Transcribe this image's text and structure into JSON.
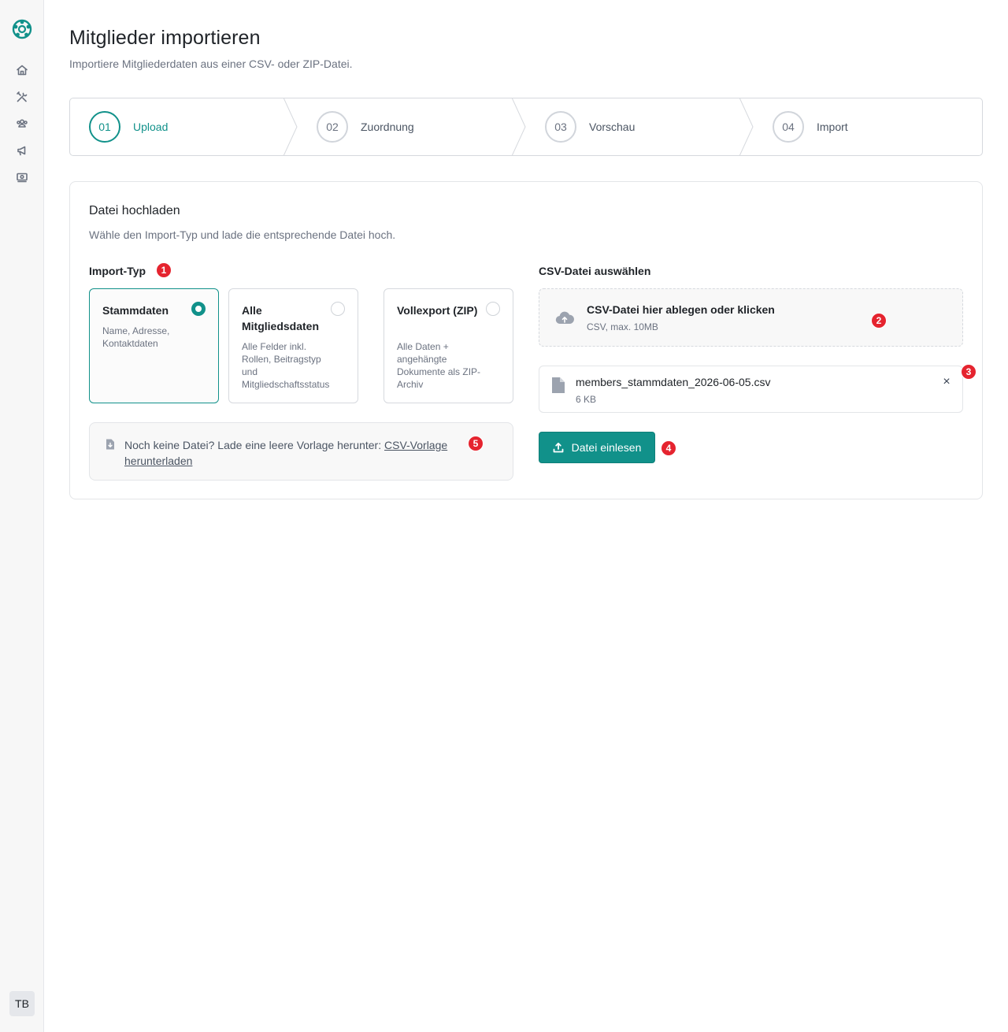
{
  "sidebar": {
    "logo_icon": "club-logo-icon",
    "items": [
      {
        "icon": "home-icon"
      },
      {
        "icon": "tools-icon"
      },
      {
        "icon": "users-icon"
      },
      {
        "icon": "megaphone-icon"
      },
      {
        "icon": "money-icon"
      }
    ],
    "avatar_initials": "TB"
  },
  "page": {
    "title": "Mitglieder importieren",
    "subtitle": "Importiere Mitgliederdaten aus einer CSV- oder ZIP-Datei."
  },
  "stepper": {
    "steps": [
      {
        "number": "01",
        "label": "Upload",
        "active": true
      },
      {
        "number": "02",
        "label": "Zuordnung",
        "active": false
      },
      {
        "number": "03",
        "label": "Vorschau",
        "active": false
      },
      {
        "number": "04",
        "label": "Import",
        "active": false
      }
    ]
  },
  "upload": {
    "title": "Datei hochladen",
    "description": "Wähle den Import-Typ und lade die entsprechende Datei hoch.",
    "import_type_label": "Import-Typ",
    "types": [
      {
        "title": "Stammdaten",
        "description": "Name, Adresse, Kontaktdaten",
        "selected": true
      },
      {
        "title": "Alle Mitgliedsdaten",
        "description": "Alle Felder inkl. Rollen, Beitragstyp und Mitgliedschaftsstatus",
        "selected": false
      },
      {
        "title": "Vollexport (ZIP)",
        "description": "Alle Daten + angehängte Dokumente als ZIP-Archiv",
        "selected": false
      }
    ],
    "hint": {
      "text": "Noch keine Datei? Lade eine leere Vorlage herunter: ",
      "link": "CSV-Vorlage herunterladen"
    },
    "file_select_label": "CSV-Datei auswählen",
    "dropzone": {
      "title": "CSV-Datei hier ablegen oder klicken",
      "subtitle": "CSV, max. 10MB"
    },
    "file": {
      "name": "members_stammdaten_2026-06-05.csv",
      "size": "6 KB",
      "remove_symbol": "×"
    },
    "submit_label": "Datei einlesen"
  },
  "badges": [
    "1",
    "2",
    "3",
    "4",
    "5"
  ],
  "colors": {
    "accent": "#11918a",
    "badge": "#e5242f",
    "border": "#d6d9de"
  }
}
